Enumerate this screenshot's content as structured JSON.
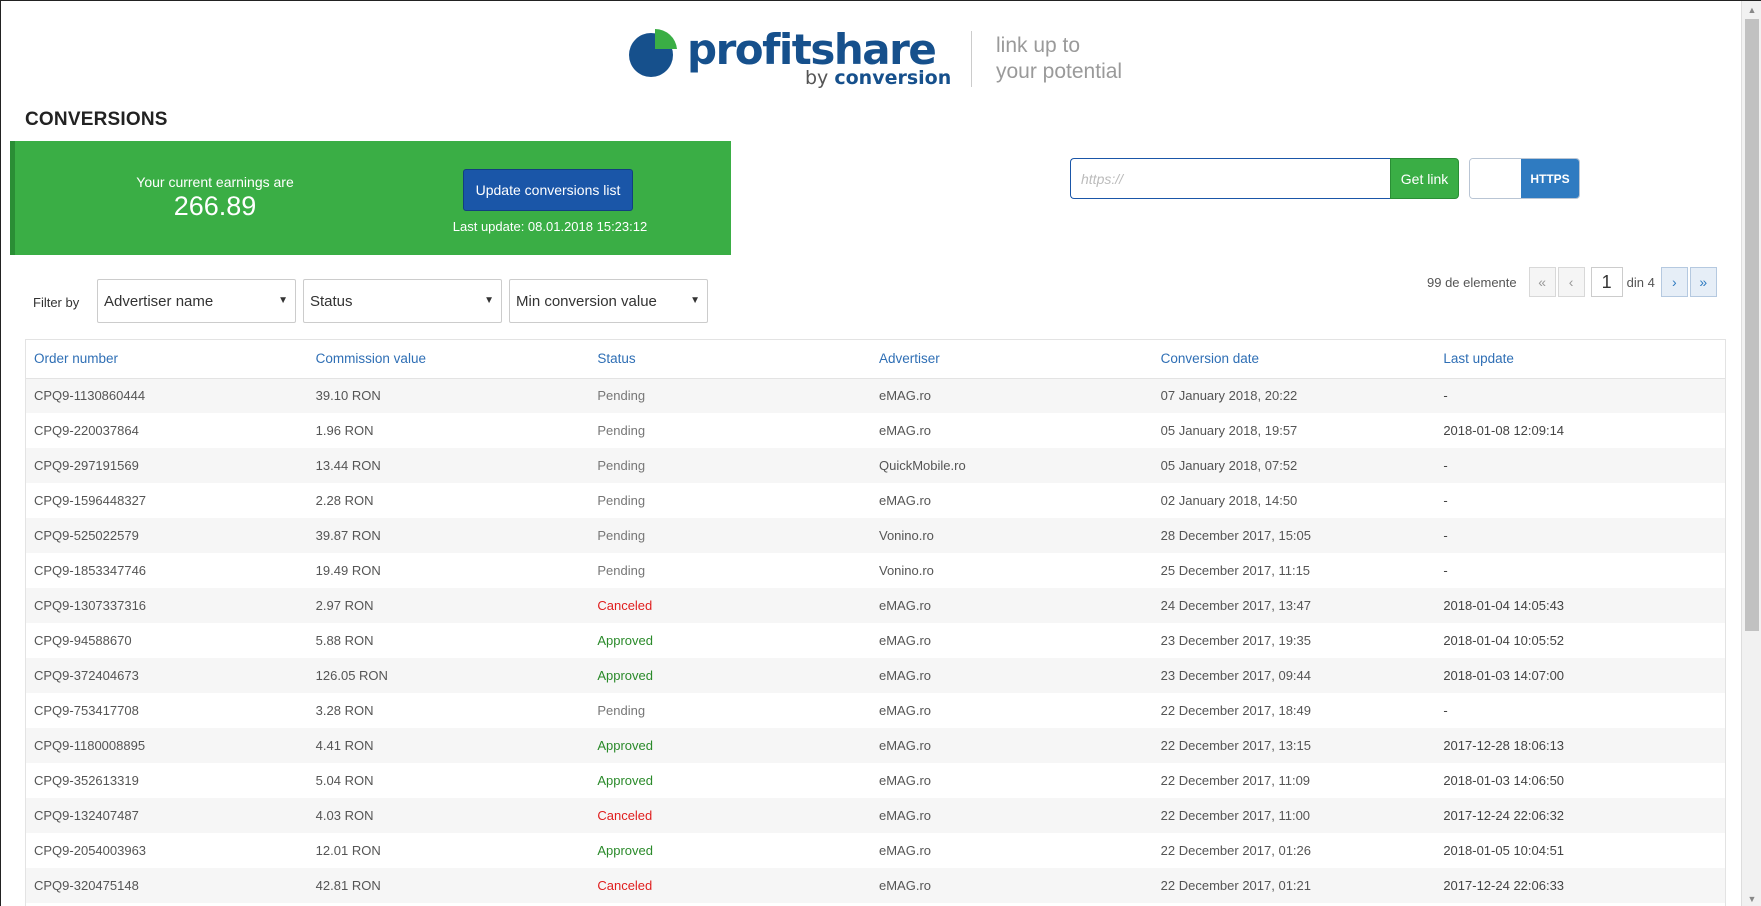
{
  "brand": {
    "name": "profitshare",
    "by_prefix": "by",
    "by_name": "conversion",
    "tagline_line1": "link up to",
    "tagline_line2": "your potential",
    "blue": "#16508c",
    "green": "#3aae45"
  },
  "page_title": "CONVERSIONS",
  "earnings": {
    "label": "Your current earnings are",
    "value": "266.89",
    "update_button": "Update conversions list",
    "last_update": "Last update: 08.01.2018 15:23:12"
  },
  "link_generator": {
    "placeholder": "https://",
    "button": "Get link",
    "toggle_label": "HTTPS"
  },
  "filters": {
    "label": "Filter by",
    "advertiser": "Advertiser name",
    "status": "Status",
    "min_value": "Min conversion value"
  },
  "pagination": {
    "count": "99 de elemente",
    "first": "«",
    "prev": "‹",
    "current": "1",
    "of": "din 4",
    "next": "›",
    "last": "»"
  },
  "table": {
    "headers": [
      "Order number",
      "Commission value",
      "Status",
      "Advertiser",
      "Conversion date",
      "Last update"
    ],
    "rows": [
      {
        "order": "CPQ9-1130860444",
        "commission": "39.10 RON",
        "status": "Pending",
        "advertiser": "eMAG.ro",
        "date": "07 January 2018, 20:22",
        "updated": "-"
      },
      {
        "order": "CPQ9-220037864",
        "commission": "1.96 RON",
        "status": "Pending",
        "advertiser": "eMAG.ro",
        "date": "05 January 2018, 19:57",
        "updated": "2018-01-08 12:09:14"
      },
      {
        "order": "CPQ9-297191569",
        "commission": "13.44 RON",
        "status": "Pending",
        "advertiser": "QuickMobile.ro",
        "date": "05 January 2018, 07:52",
        "updated": "-"
      },
      {
        "order": "CPQ9-1596448327",
        "commission": "2.28 RON",
        "status": "Pending",
        "advertiser": "eMAG.ro",
        "date": "02 January 2018, 14:50",
        "updated": "-"
      },
      {
        "order": "CPQ9-525022579",
        "commission": "39.87 RON",
        "status": "Pending",
        "advertiser": "Vonino.ro",
        "date": "28 December 2017, 15:05",
        "updated": "-"
      },
      {
        "order": "CPQ9-1853347746",
        "commission": "19.49 RON",
        "status": "Pending",
        "advertiser": "Vonino.ro",
        "date": "25 December 2017, 11:15",
        "updated": "-"
      },
      {
        "order": "CPQ9-1307337316",
        "commission": "2.97 RON",
        "status": "Canceled",
        "advertiser": "eMAG.ro",
        "date": "24 December 2017, 13:47",
        "updated": "2018-01-04 14:05:43"
      },
      {
        "order": "CPQ9-94588670",
        "commission": "5.88 RON",
        "status": "Approved",
        "advertiser": "eMAG.ro",
        "date": "23 December 2017, 19:35",
        "updated": "2018-01-04 10:05:52"
      },
      {
        "order": "CPQ9-372404673",
        "commission": "126.05 RON",
        "status": "Approved",
        "advertiser": "eMAG.ro",
        "date": "23 December 2017, 09:44",
        "updated": "2018-01-03 14:07:00"
      },
      {
        "order": "CPQ9-753417708",
        "commission": "3.28 RON",
        "status": "Pending",
        "advertiser": "eMAG.ro",
        "date": "22 December 2017, 18:49",
        "updated": "-"
      },
      {
        "order": "CPQ9-1180008895",
        "commission": "4.41 RON",
        "status": "Approved",
        "advertiser": "eMAG.ro",
        "date": "22 December 2017, 13:15",
        "updated": "2017-12-28 18:06:13"
      },
      {
        "order": "CPQ9-352613319",
        "commission": "5.04 RON",
        "status": "Approved",
        "advertiser": "eMAG.ro",
        "date": "22 December 2017, 11:09",
        "updated": "2018-01-03 14:06:50"
      },
      {
        "order": "CPQ9-132407487",
        "commission": "4.03 RON",
        "status": "Canceled",
        "advertiser": "eMAG.ro",
        "date": "22 December 2017, 11:00",
        "updated": "2017-12-24 22:06:32"
      },
      {
        "order": "CPQ9-2054003963",
        "commission": "12.01 RON",
        "status": "Approved",
        "advertiser": "eMAG.ro",
        "date": "22 December 2017, 01:26",
        "updated": "2018-01-05 10:04:51"
      },
      {
        "order": "CPQ9-320475148",
        "commission": "42.81 RON",
        "status": "Canceled",
        "advertiser": "eMAG.ro",
        "date": "22 December 2017, 01:21",
        "updated": "2017-12-24 22:06:33"
      }
    ]
  },
  "status_colors": {
    "Pending": "#777777",
    "Canceled": "#e01e1e",
    "Approved": "#2a8a2a"
  }
}
